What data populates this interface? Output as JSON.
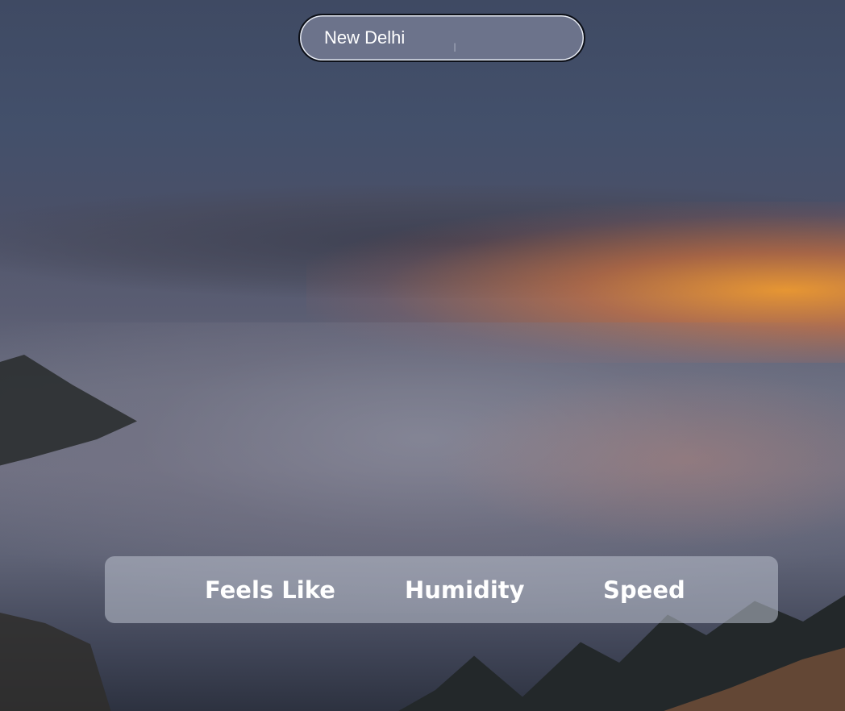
{
  "search": {
    "value": "New Delhi",
    "placeholder": ""
  },
  "stats": {
    "feels_like_label": "Feels Like",
    "humidity_label": "Humidity",
    "speed_label": "Speed"
  },
  "colors": {
    "panel_background": "#bec2d0",
    "text": "#ffffff",
    "search_background": "#70768e"
  },
  "background": {
    "description_icon": "sunset-over-clouds-image"
  }
}
